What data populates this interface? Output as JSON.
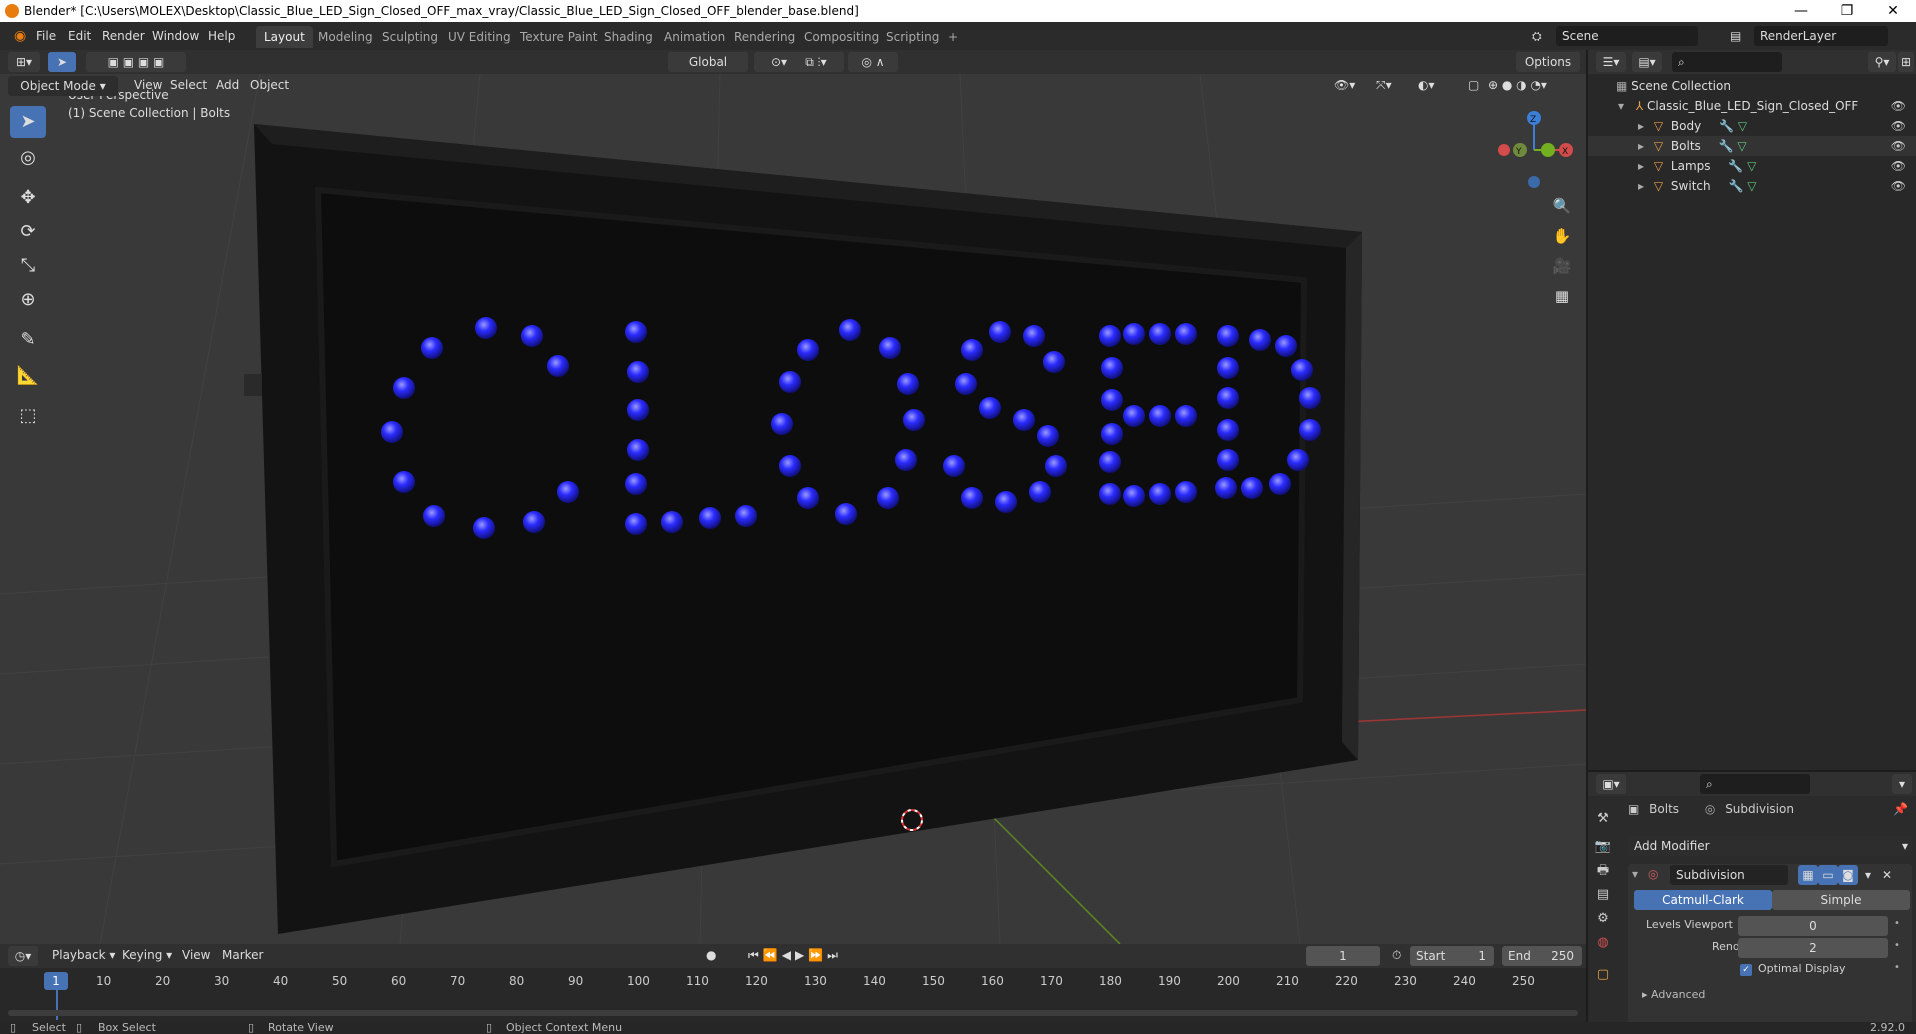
{
  "window": {
    "title": "Blender* [C:\\Users\\MOLEX\\Desktop\\Classic_Blue_LED_Sign_Closed_OFF_max_vray/Classic_Blue_LED_Sign_Closed_OFF_blender_base.blend]",
    "minimize": "—",
    "restore": "❐",
    "close": "✕"
  },
  "menu": [
    "File",
    "Edit",
    "Render",
    "Window",
    "Help"
  ],
  "workspaces": [
    "Layout",
    "Modeling",
    "Sculpting",
    "UV Editing",
    "Texture Paint",
    "Shading",
    "Animation",
    "Rendering",
    "Compositing",
    "Scripting"
  ],
  "add_workspace": "+",
  "scene": {
    "name": "Scene",
    "render_layer": "RenderLayer"
  },
  "viewport_header": {
    "mode": "Object Mode",
    "menus": [
      "View",
      "Select",
      "Add",
      "Object"
    ],
    "transform_orientation": "Global",
    "options": "Options"
  },
  "viewport": {
    "perspective": "User Perspective",
    "collection_info": "(1) Scene Collection | Bolts",
    "sign_text": "CLOSED",
    "led_color": "#2b2bff",
    "frame_color": "#141414",
    "axis": {
      "x": "X",
      "y": "Y",
      "z": "Z"
    }
  },
  "outliner": {
    "root": "Scene Collection",
    "object": "Classic_Blue_LED_Sign_Closed_OFF",
    "children": [
      "Body",
      "Bolts",
      "Lamps",
      "Switch"
    ]
  },
  "properties": {
    "object": "Bolts",
    "modifier": "Subdivision",
    "add_modifier": "Add Modifier",
    "modifier_name": "Subdivision",
    "mode_catmull": "Catmull-Clark",
    "mode_simple": "Simple",
    "levels_viewport_label": "Levels Viewport",
    "levels_viewport": "0",
    "render_label": "Render",
    "render_value": "2",
    "optimal_display": "Optimal Display",
    "advanced": "Advanced"
  },
  "timeline": {
    "menus": [
      "Playback",
      "Keying",
      "View",
      "Marker"
    ],
    "current_frame": "1",
    "start_label": "Start",
    "start": "1",
    "end_label": "End",
    "end": "250",
    "ticks": [
      "1",
      "10",
      "20",
      "30",
      "40",
      "50",
      "60",
      "70",
      "80",
      "90",
      "100",
      "110",
      "120",
      "130",
      "140",
      "150",
      "160",
      "170",
      "180",
      "190",
      "200",
      "210",
      "220",
      "230",
      "240",
      "250"
    ]
  },
  "status": {
    "select": "Select",
    "box_select": "Box Select",
    "rotate": "Rotate View",
    "context": "Object Context Menu",
    "version": "2.92.0"
  }
}
